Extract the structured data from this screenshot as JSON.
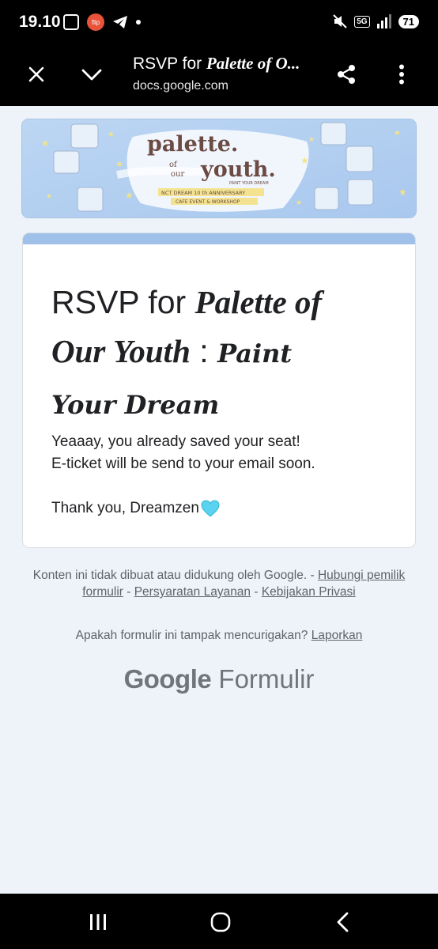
{
  "status_bar": {
    "time": "19.10",
    "flip_badge": "flip",
    "network": "5G",
    "battery": "71"
  },
  "toolbar": {
    "title_plain": "RSVP for ",
    "title_italic": "Palette of O...",
    "url": "docs.google.com"
  },
  "banner": {
    "word1": "palette.",
    "word_of": "of",
    "word_our": "our",
    "word2": "youth.",
    "tagline": "PAINT YOUR DREAM",
    "line1": "NCT DREAM 10 th ANNIVERSARY",
    "line2": "CAFE EVENT & WORKSHOP"
  },
  "form": {
    "title_plain": "RSVP for ",
    "title_serif_1": "Palette of",
    "title_serif_2": "Our Youth",
    "title_colon": " : ",
    "title_script_1": "Paint",
    "title_script_2": "Your Dream",
    "confirm_line1": "Yeaaay, you already saved your seat!",
    "confirm_line2": "E-ticket will be send to your email soon.",
    "thanks": "Thank you, Dreamzen"
  },
  "footer": {
    "disclaimer": "Konten ini tidak dibuat atau didukung oleh Google.",
    "sep": " - ",
    "link_owner": "Hubungi pemilik formulir",
    "link_terms": "Persyaratan Layanan",
    "link_privacy": "Kebijakan Privasi",
    "report_question": "Apakah formulir ini tampak mencurigakan?",
    "report_link": "Laporkan",
    "brand_google": "Google",
    "brand_product": "Formulir"
  },
  "colors": {
    "accent": "#9ec0e9",
    "background": "#eef3fa",
    "heart": "#59d3ef"
  }
}
